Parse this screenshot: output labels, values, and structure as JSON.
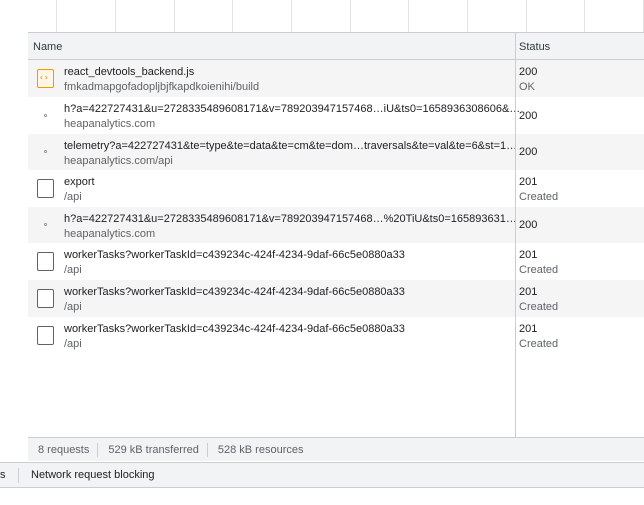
{
  "columns": {
    "name": "Name",
    "status": "Status"
  },
  "requests": [
    {
      "icon": "script",
      "name": "react_devtools_backend.js",
      "sub": "fmkadmapgofadopljbjfkapdkoienihi/build",
      "status": "200",
      "status_text": "OK"
    },
    {
      "icon": "dot",
      "name": "h?a=422727431&u=2728335489608171&v=789203947157468…iU&ts0=1658936308606&…",
      "sub": "heapanalytics.com",
      "status": "200",
      "status_text": ""
    },
    {
      "icon": "dot",
      "name": "telemetry?a=422727431&te=type&te=data&te=cm&te=dom…traversals&te=val&te=6&st=1…",
      "sub": "heapanalytics.com/api",
      "status": "200",
      "status_text": ""
    },
    {
      "icon": "doc",
      "name": "export",
      "sub": "/api",
      "status": "201",
      "status_text": "Created"
    },
    {
      "icon": "dot",
      "name": "h?a=422727431&u=2728335489608171&v=789203947157468…%20TiU&ts0=165893631…",
      "sub": "heapanalytics.com",
      "status": "200",
      "status_text": ""
    },
    {
      "icon": "doc",
      "name": "workerTasks?workerTaskId=c439234c-424f-4234-9daf-66c5e0880a33",
      "sub": "/api",
      "status": "201",
      "status_text": "Created"
    },
    {
      "icon": "doc",
      "name": "workerTasks?workerTaskId=c439234c-424f-4234-9daf-66c5e0880a33",
      "sub": "/api",
      "status": "201",
      "status_text": "Created"
    },
    {
      "icon": "doc",
      "name": "workerTasks?workerTaskId=c439234c-424f-4234-9daf-66c5e0880a33",
      "sub": "/api",
      "status": "201",
      "status_text": "Created"
    }
  ],
  "summary": {
    "requests": "8 requests",
    "transferred": "529 kB transferred",
    "resources": "528 kB resources"
  },
  "drawer": {
    "partial_tab": "s",
    "tab": "Network request blocking"
  }
}
